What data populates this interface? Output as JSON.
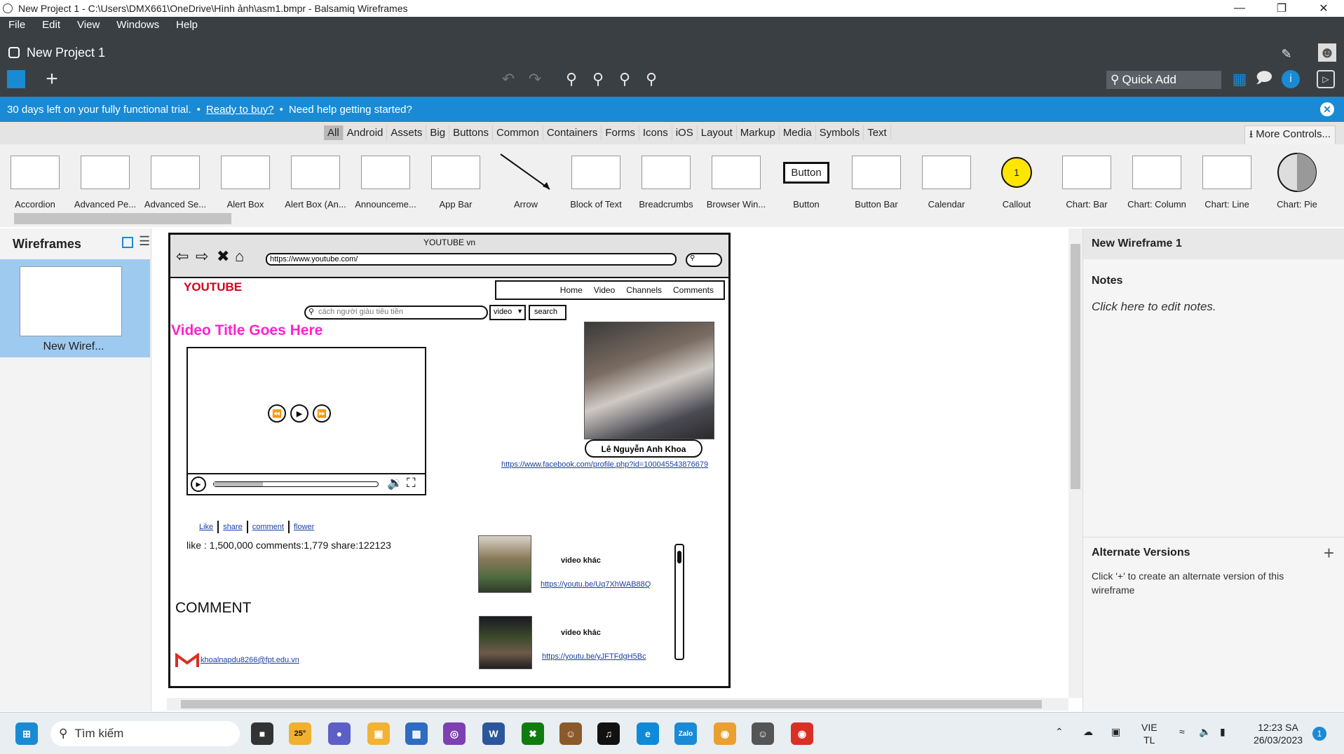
{
  "window": {
    "title": "New Project 1 - C:\\Users\\DMX661\\OneDrive\\Hình ảnh\\asm1.bmpr - Balsamiq Wireframes"
  },
  "menu": [
    "File",
    "Edit",
    "View",
    "Windows",
    "Help"
  ],
  "project": {
    "name": "New Project 1"
  },
  "toolbar": {
    "quick_add": "Quick Add"
  },
  "trial": {
    "message": "30 days left on your fully functional trial.",
    "bullet": "•",
    "buy_link": "Ready to buy?",
    "help": "Need help getting started?"
  },
  "categories": [
    "All",
    "Android",
    "Assets",
    "Big",
    "Buttons",
    "Common",
    "Containers",
    "Forms",
    "Icons",
    "iOS",
    "Layout",
    "Markup",
    "Media",
    "Symbols",
    "Text"
  ],
  "more_controls": "More Controls...",
  "controls": [
    "Accordion",
    "Advanced Pe...",
    "Advanced Se...",
    "Alert Box",
    "Alert Box (An...",
    "Announceme...",
    "App Bar",
    "Arrow",
    "Block of Text",
    "Breadcrumbs",
    "Browser Win...",
    "Button",
    "Button Bar",
    "Calendar",
    "Callout",
    "Chart: Bar",
    "Chart: Column",
    "Chart: Line",
    "Chart: Pie"
  ],
  "control_thumbs": {
    "button": "Button",
    "callout": "1"
  },
  "left_panel": {
    "title": "Wireframes",
    "item_label": "New Wiref..."
  },
  "right_panel": {
    "header": "New Wireframe 1",
    "notes_title": "Notes",
    "notes_hint": "Click here to edit notes.",
    "alt_title": "Alternate Versions",
    "alt_hint": "Click '+' to create an alternate version of this wireframe"
  },
  "wireframe": {
    "browser_title": "YOUTUBE vn",
    "url": "https://www.youtube.com/",
    "logo": "YOUTUBE",
    "nav": [
      "Home",
      "Video",
      "Channels",
      "Comments"
    ],
    "search_placeholder": "cách người giàu tiêu tiền",
    "select_value": "video",
    "search_button": "search",
    "video_title": "Video Title Goes Here",
    "profile_name": "Lê Nguyễn Anh Khoa",
    "profile_link": "https://www.facebook.com/profile.php?id=100045543876679",
    "actions": [
      "Like",
      "share",
      "comment",
      "flower"
    ],
    "stats": "like : 1,500,000 comments:1,779 share:122123",
    "comment_heading": "COMMENT",
    "email": "khoalnapdu8266@fpt.edu.vn",
    "related": [
      {
        "title": "video khác",
        "link": "https://youtu.be/Uq7XhWAB88Q"
      },
      {
        "title": "video khác",
        "link": "https://youtu.be/yJFTFdgH5Bc"
      }
    ]
  },
  "taskbar": {
    "search_placeholder": "Tìm kiếm",
    "weather": "25°",
    "lang": "VIE",
    "lang2": "TL",
    "time": "12:23 SA",
    "date": "26/03/2023",
    "notif_count": "1"
  },
  "colors": {
    "accent": "#1a8ad4",
    "dark": "#3a3f44",
    "logo_red": "#d6001c",
    "title_pink": "#ff22cc"
  }
}
